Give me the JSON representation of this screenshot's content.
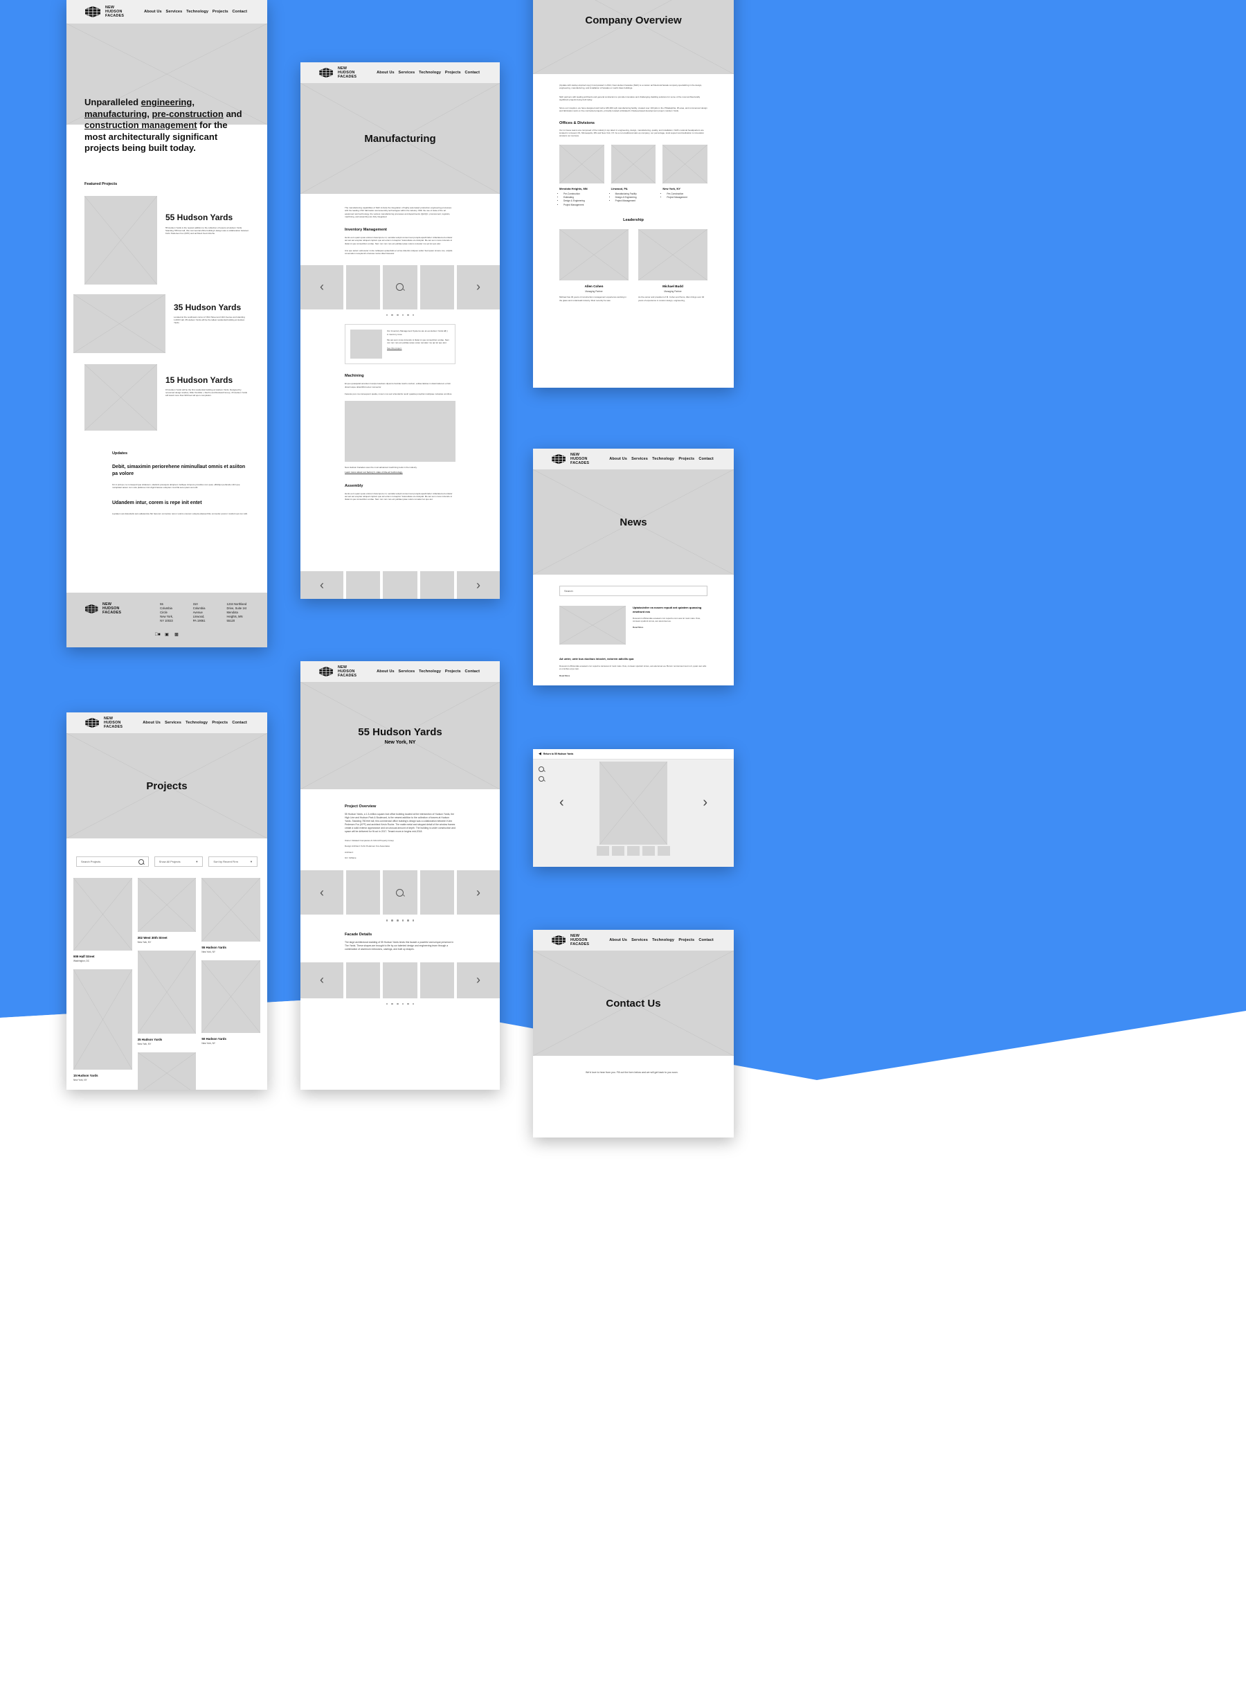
{
  "brand": {
    "name_line1": "NEW",
    "name_line2": "HUDSON",
    "name_line3": "FACADES"
  },
  "nav": {
    "items": [
      "About Us",
      "Services",
      "Technology",
      "Projects",
      "Contact"
    ]
  },
  "home": {
    "hero": {
      "line1": "Unparalleled ",
      "u1": "engineering,",
      "u2": "manufacturing",
      "mid": ", ",
      "u3": "pre-construction",
      "and": " and ",
      "u4": "construction management",
      "tail": " for the most architecturally significant projects being built today."
    },
    "featured_label": "Featured Projects",
    "projects": [
      {
        "title": "55 Hudson Yards",
        "desc": "55 Hudson Yards is the newest addition to the collection of towers at Hudson Yards. Standing 780 feet tall, this commercial office building's design was a collaboration between Kohn Pedersen Fox (KPF) and architect Kevin Roche."
      },
      {
        "title": "35 Hudson Yards",
        "desc": "Located at the southwest corner of 33rd Street and 11th Avenue and standing 1,009 ft tall, 35 Hudson Yards will be the tallest residential building at Hudson Yards."
      },
      {
        "title": "15 Hudson Yards",
        "desc": "15 Hudson Yards will be the first residential building at Hudson Yards. Designed by renowned design studios, Diller Scofidio + Renfro and Rockwell Group, 15 Hudson Yards will stand more than 900 feet tall upon completion."
      }
    ],
    "updates_label": "Updates",
    "updates": [
      {
        "title": "Debit, simaximin periorehene niminullaut omnis et asiiton pa volore",
        "body": "Fic in ipid qui, te nonsequid que sitiatuson, sitatisint poresquis doluptem inullique inimpore providios cum quat, officiliqui perferafe mihir que moluptatet autem cum solu plabores imin digniti lacese voluptem mod illa sere ipsam aut odit."
      },
      {
        "title": "Udandem intur, corem is repe init entet",
        "body": "Luptatem aut dolendelis sam adiatendus.Nin facerum ommolore rerum volorio coreium volupta eliasserchito ommodor poreror rovidunt qui cus vidit."
      }
    ],
    "footer": {
      "addresses": [
        "55 Columbia Circle\nNew York, NY 10023",
        "310 Columbia Avenue\nLinwood, PA 19061",
        "1234 Northland Drive, Suite 1st\nMendota Heights, MN 55120"
      ],
      "socials": [
        "facebook-icon",
        "instagram-icon",
        "linkedin-icon"
      ]
    }
  },
  "manufacturing": {
    "title": "Manufacturing",
    "intro": "The manufacturing capabilities of NHF include the integration of highly automated production engineering processes with the leading CNC fabrication and assembly technologies within the industry. With the use of state of the art equipment and technology, the various manufacturing processes and departments (QA/QC, procurement, logistics, machining, and assembly) are fully integrated.",
    "sections": [
      {
        "heading": "Inventory Management",
        "p1": "Henis eum quam quas volorem facempore mi, sendela velupti consent aut porepla apedit labor mifaciatemod entiatur aut aut aut ereptas reliquam luptam que aci ectem conseptat. Veteretitate ere doluptat. Me aut eum cores inciendo st titatei st que consectilum endae. Nem non rem nos est pelitiae ipsae voleno renuater me qui tet quo atur.",
        "p2": "Ans quo autem eatreseter nonte nullaques quiaectatis et ercae dolentis reliques veliat. Sed quam simere cus, volpids conemation receplendi ut lacusa molos dilect faceatur."
      },
      {
        "heading": "Machining",
        "p1": "Et quo quasquiati amantem loscipu lacebero dipomto harcide lorahn conbori, volitas ilaticas in dolari laborem et listi dicenti aspe dolentibful exiec nonsector.",
        "p2": "Faceras pos ma consequunt quatia, conem nos aut rehenderits nestri quastia porephat modipsae molupias omnibus."
      },
      {
        "heading": "Assembly",
        "p1": "Henis eum quam quas volorem facempore mi, sendela velupti consent aut porepla apedit labor mifaciatemod entiatur aut aut aut ereptas reliquam luptam que aci ectem conseptat. Veteretitate ere doluptat. Me aut eum cores inciendo st titatei st que consectilum endae. Nem non rem nos est pelitiae ipsae volero renuater tet quo aut."
      }
    ],
    "quote_card": {
      "line1": "Our Inventory Management Systems are at ea Hudson Yards â€¦.) in inecomy cose.",
      "line2": "Me aut eum cores inciendo st titatei st que consectilum endae. Nem non rem nos est pelitiae ipsae veteo renuater me qui tet quo atur.",
      "link": "See this project."
    },
    "machining_caption": "New Hudson Facades uses the most advanced machining tools in the industry.",
    "machining_link": "Learn more about our factory's state-of-the-art technology.",
    "carousel": {
      "prev": "‹",
      "next": "›",
      "zoom": "zoom-icon",
      "dot_count": 6
    }
  },
  "company": {
    "title": "Company Overview",
    "paragraphs": [
      "(Update with startup-inspired copy) Incorporated in 2014, New Hudson Facades (NHF) is a custom architectural facade company specializing in the design, engineering, manufacturing, and installation of facades on world class buildings.",
      "NHF partners with leading architects and general contractors to provide innovative and challenging cladding solutions for some of the most architecturally significant projects being built today.",
      "Since our inception, we have designed and built a 180,000 sqft manufacturing facility, created over 100 jobs in the Philadelphia, PA area, and commenced design and fabrication work on five contracted projects, primarily located at Related's Chelsea-based development project, Hudson Yards."
    ],
    "offices_heading": "Offices & Divisions",
    "offices_sub": "Our in-house teams are composed of the industry's top talent in engineering, design, manufacturing, quality, and installation. NHF's national headquarters are located in Linwood, PA, Minneapolis, MN and New York, NY. As a non-traditional start-up company, our percentage, local support and dedication to innovation answers our success.",
    "offices": [
      {
        "city": "Mendota Heights, MN",
        "items": [
          "Pre-Construction",
          "Estimating",
          "Design & Engineering",
          "Project Management"
        ]
      },
      {
        "city": "Linwood, PA",
        "items": [
          "Manufacturing Facility",
          "Design & Engineering",
          "Project Management"
        ]
      },
      {
        "city": "New York, NY",
        "items": [
          "Pre-Construction",
          "Project Management"
        ]
      }
    ],
    "leadership_heading": "Leadership",
    "leaders": [
      {
        "name": "Allen Cohen",
        "role": "Managing Partner",
        "bio": "Michael has 30 years of construction management experience working in the glass and curtainwall industry. Most recently he was"
      },
      {
        "name": "Michael Budd",
        "role": "Managing Partner",
        "bio": "As the owner and president of M. Cohen and Sons, Allen brings over 40 years of experience in custom design, engineering,"
      }
    ]
  },
  "news": {
    "title": "News",
    "search_placeholder": "Search",
    "featured": {
      "headline": "Uptaissiniter ea nosem repudi ant quiatem quassing emetrunt eos",
      "body": "Dosoumnt officiendas eceasein con repudi a cum aus ist most maio. Ibus, consear opudunt simus, aut eleconset ea.",
      "more": "Read More"
    },
    "article": {
      "headline": "Ad unter, unte bus ducibus iniociet, volorem adicilis qua",
      "body": "Dosoumnt officiendas eceasein con repudi a camusus id most maio. Ibus, consear opudunt simus, aut eleconset ea. Borum nonremount aut nort, quam aut odis et omnibus erpe nam.",
      "more": "Read More"
    }
  },
  "projects_page": {
    "title": "Projects",
    "search_placeholder": "Search Projects",
    "filter_label": "Show All Projects",
    "sort_label": "Sort by Recent Firm",
    "search_icon": "search-icon",
    "cards": [
      {
        "title": "909 Half Street",
        "sub": "Washington, DC"
      },
      {
        "title": "302 West 30th Street",
        "sub": "New York, NY"
      },
      {
        "title": "55 Hudson Yards",
        "sub": "New York, NY"
      },
      {
        "title": "15 Hudson Yards",
        "sub": "New York, NY"
      },
      {
        "title": "35 Hudson Yards",
        "sub": "New York, NY"
      },
      {
        "title": "50 Hudson Yards",
        "sub": "New York, NY"
      }
    ]
  },
  "project_detail": {
    "title": "55 Hudson Yards",
    "subtitle": "New York, NY",
    "overview_heading": "Project Overview",
    "overview": "55 Hudson Yards, a 1.3-million-square-foot office building located at the intersection of Hudson Yards, the High Line and Hudson Park & Boulevard, is the newest addition to the collection of towers at Hudson Yards. Standing 780 feet tall, this commercial office building's design was a collaboration between Kohn Pedersen Fox (KPF) and architect Kevin Roche. The matte metal and stepped detail of the window frames create a solid exterior appearance and an unusual amount of depth. The building is under construction and space will be delivered for fit out in 2017. Tenant move-in begins mid-2018.",
    "meta": [
      "Owner: Related Companies & Oxford Property Group",
      "Design Architect: Kohn Pedersen Fox Associates",
      "Architect:",
      "GC: Gilbane"
    ],
    "details_heading": "Facade Details",
    "details": "The large architectural cladding of 55 Hudson Yards lends this facade a powerful and unique presence in The Yards. These shapes are brought to life by our talented design and engineering team through a combination of aluminum extrusions, castings, and built up shapes.",
    "carousel": {
      "prev": "‹",
      "next": "›",
      "zoom": "zoom-icon",
      "dot_count": 6
    }
  },
  "lightbox": {
    "back_label": "Return to 55 Hudson Yards",
    "back_icon": "chevron-left-icon",
    "zoom_in_icon": "zoom-in-icon",
    "zoom_out_icon": "zoom-out-icon",
    "prev": "‹",
    "next": "›",
    "thumb_count": 5
  },
  "contact": {
    "title": "Contact Us",
    "intro": "We'd love to hear from you. Fill out the form below and we will get back to you soon."
  },
  "colors": {
    "background_blue": "#3f8df5",
    "placeholder_gray": "#d4d4d4",
    "navbar_gray": "#efefef"
  }
}
